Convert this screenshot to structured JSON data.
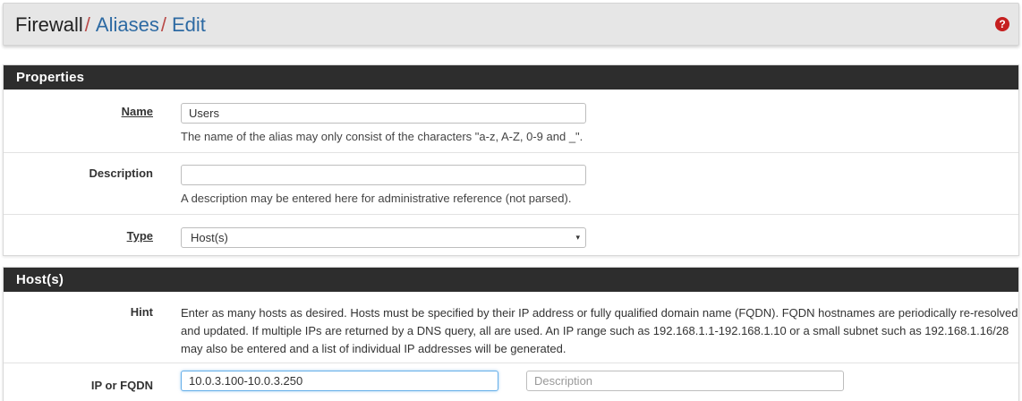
{
  "breadcrumb": {
    "root": "Firewall",
    "level1": "Aliases",
    "level2": "Edit",
    "separator": "/"
  },
  "help_icon": {
    "glyph": "?",
    "icon": "question-circle-icon",
    "color": "#c51f1f"
  },
  "properties": {
    "heading": "Properties",
    "name": {
      "label": "Name",
      "value": "Users",
      "help": "The name of the alias may only consist of the characters \"a-z, A-Z, 0-9 and _\"."
    },
    "description": {
      "label": "Description",
      "value": "",
      "help": "A description may be entered here for administrative reference (not parsed)."
    },
    "type": {
      "label": "Type",
      "selected": "Host(s)",
      "caret": "▾"
    }
  },
  "hosts": {
    "heading": "Host(s)",
    "hint_label": "Hint",
    "hint_text": "Enter as many hosts as desired. Hosts must be specified by their IP address or fully qualified domain name (FQDN). FQDN hostnames are periodically re-resolved and updated. If multiple IPs are returned by a DNS query, all are used. An IP range such as 192.168.1.1-192.168.1.10 or a small subnet such as 192.168.1.16/28 may also be entered and a list of individual IP addresses will be generated.",
    "ip_label": "IP or FQDN",
    "ip_value": "10.0.3.100-10.0.3.250",
    "desc_placeholder": "Description"
  },
  "colors": {
    "panel_heading": "#2d2d2d",
    "link": "#2d6aa3",
    "separator": "#b94a48"
  }
}
